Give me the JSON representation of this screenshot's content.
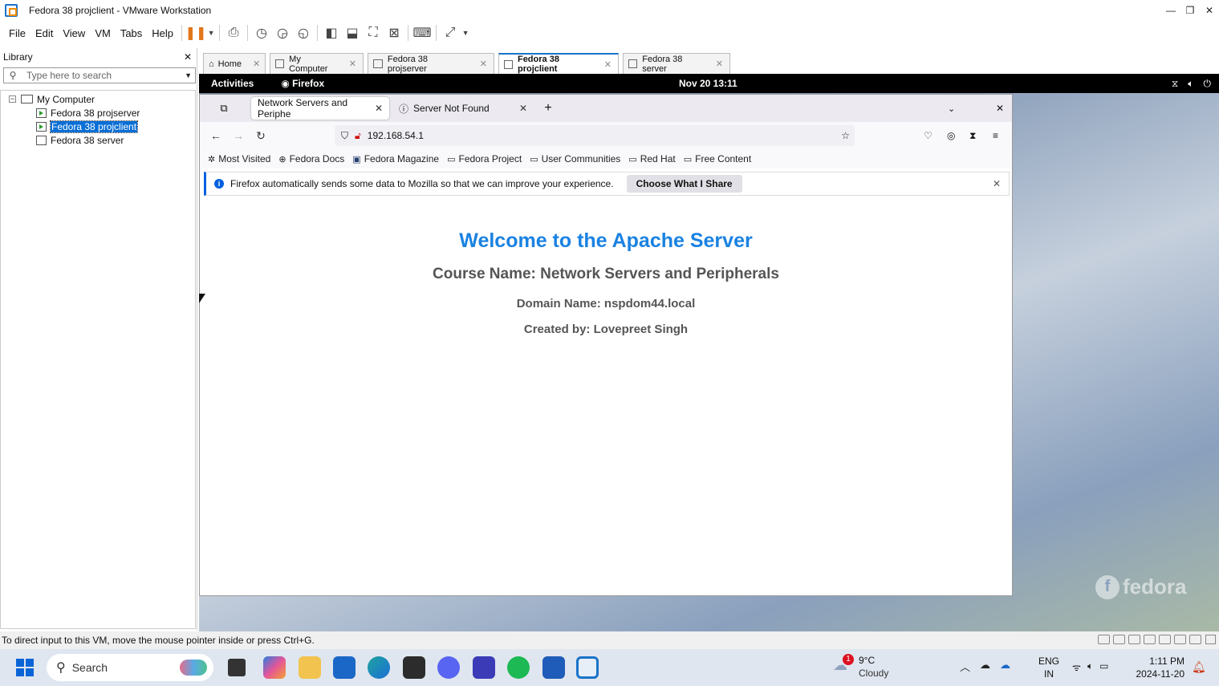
{
  "window": {
    "title": "Fedora 38 projclient - VMware Workstation",
    "controls": [
      "—",
      "❐",
      "✕"
    ]
  },
  "menubar": {
    "items": [
      "File",
      "Edit",
      "View",
      "VM",
      "Tabs",
      "Help"
    ]
  },
  "library": {
    "title": "Library",
    "close": "✕",
    "search_placeholder": "Type here to search",
    "tree": {
      "root": "My Computer",
      "items": [
        "Fedora 38 projserver",
        "Fedora 38 projclient",
        "Fedora 38 server"
      ],
      "selected": "Fedora 38 projclient"
    }
  },
  "vm_tabs": [
    {
      "label": "Home",
      "close": "✕"
    },
    {
      "label": "My Computer",
      "close": "✕"
    },
    {
      "label": "Fedora 38 projserver",
      "close": "✕"
    },
    {
      "label": "Fedora 38 projclient",
      "close": "✕",
      "active": true
    },
    {
      "label": "Fedora 38 server",
      "close": "✕"
    }
  ],
  "gnome": {
    "activities": "Activities",
    "app": "Firefox",
    "clock": "Nov 20  13:11"
  },
  "firefox": {
    "tabs": [
      {
        "label": "Network Servers and Periphe",
        "close": "✕",
        "active": true
      },
      {
        "label": "Server Not Found",
        "close": "✕"
      }
    ],
    "new_tab": "+",
    "url": "192.168.54.1",
    "bookmarks": [
      "Most Visited",
      "Fedora Docs",
      "Fedora Magazine",
      "Fedora Project",
      "User Communities",
      "Red Hat",
      "Free Content"
    ],
    "notice": {
      "text": "Firefox automatically sends some data to Mozilla so that we can improve your experience.",
      "button": "Choose What I Share",
      "close": "✕"
    },
    "page": {
      "heading": "Welcome to the Apache Server",
      "course": "Course Name: Network Servers and Peripherals",
      "domain": "Domain Name: nspdom44.local",
      "created": "Created by: Lovepreet Singh"
    }
  },
  "desktop": {
    "logo_text": "fedora"
  },
  "statusbar": {
    "text": "To direct input to this VM, move the mouse pointer inside or press Ctrl+G."
  },
  "taskbar": {
    "search": "Search",
    "weather": {
      "temp": "9°C",
      "condition": "Cloudy",
      "badge": "1"
    },
    "lang": {
      "line1": "ENG",
      "line2": "IN"
    },
    "time": "1:11 PM",
    "date": "2024-11-20"
  },
  "colors": {
    "accent": "#1a82e2",
    "selection": "#0a6fd6",
    "taskbar": "#dfe6ef"
  }
}
